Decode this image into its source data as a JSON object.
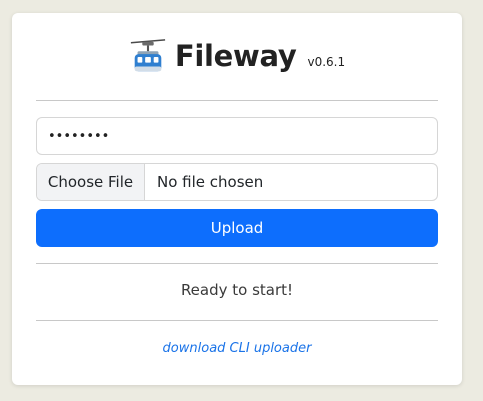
{
  "app": {
    "title": "Fileway",
    "version": "v0.6.1",
    "logo_icon": "aerial-tramway-icon"
  },
  "form": {
    "password_value": "••••••••",
    "file_button_label": "Choose File",
    "file_status": "No file chosen",
    "upload_label": "Upload"
  },
  "status": {
    "text": "Ready to start!"
  },
  "footer": {
    "cli_link": "download CLI uploader"
  },
  "colors": {
    "background": "#ecebe1",
    "card": "#ffffff",
    "primary": "#0d6efd",
    "link": "#1a73e8"
  }
}
